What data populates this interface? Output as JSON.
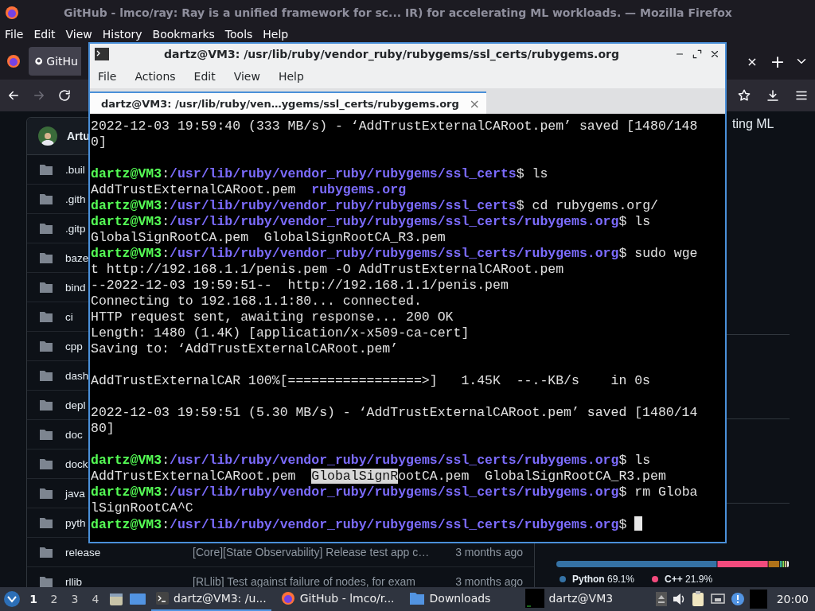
{
  "browser": {
    "title": "GitHub - lmco/ray: Ray is a unified framework for sc... IR) for accelerating ML workloads. — Mozilla Firefox",
    "menu": [
      "File",
      "Edit",
      "View",
      "History",
      "Bookmarks",
      "Tools",
      "Help"
    ],
    "tabs": [
      {
        "label": "GitHu",
        "selected": true
      }
    ],
    "tab_close": "×",
    "new_tab": "+"
  },
  "repo": {
    "owner_fragment": "Artu",
    "files": [
      {
        "name": ".buil"
      },
      {
        "name": ".gith"
      },
      {
        "name": ".gitp"
      },
      {
        "name": "baze"
      },
      {
        "name": "bind"
      },
      {
        "name": "ci"
      },
      {
        "name": "cpp"
      },
      {
        "name": "dash"
      },
      {
        "name": "depl"
      },
      {
        "name": "doc"
      },
      {
        "name": "dock"
      },
      {
        "name": "java"
      },
      {
        "name": "pyth"
      },
      {
        "name": "release",
        "message": "[Core][State Observability] Release test app c…",
        "time": "3 months ago"
      },
      {
        "name": "rllib",
        "message": "[RLlib] Test against failure of nodes, for exam",
        "time": "3 months ago"
      }
    ],
    "description_fragment": "ting ML",
    "languages": [
      {
        "name": "Python",
        "percent": "69.1%",
        "color": "#3572a5"
      },
      {
        "name": "C++",
        "percent": "21.9%",
        "color": "#f34b7d"
      }
    ]
  },
  "terminal": {
    "title": "dartz@VM3: /usr/lib/ruby/vendor_ruby/rubygems/ssl_certs/rubygems.org",
    "menu": [
      "File",
      "Actions",
      "Edit",
      "View",
      "Help"
    ],
    "tabs": [
      {
        "label": "dartz@VM3: /usr/lib/ruby/ven…ygems/ssl_certs/rubygems.org",
        "selected": true
      }
    ],
    "tab_close": "×",
    "lines": [
      {
        "kind": "text",
        "parts": [
          {
            "kind": "plain",
            "text": "2022-12-03 19:59:40 (333 MB/s) - ‘AddTrustExternalCARoot.pem’ saved [1480/148"
          }
        ]
      },
      {
        "kind": "text",
        "parts": [
          {
            "kind": "plain",
            "text": "0]"
          }
        ]
      },
      {
        "kind": "blank"
      },
      {
        "kind": "text",
        "parts": [
          {
            "kind": "user",
            "text": "dartz@VM3"
          },
          {
            "kind": "plain",
            "text": ":"
          },
          {
            "kind": "path",
            "text": "/usr/lib/ruby/vendor_ruby/rubygems/ssl_certs"
          },
          {
            "kind": "plain",
            "text": "$ ls"
          }
        ]
      },
      {
        "kind": "text",
        "parts": [
          {
            "kind": "plain",
            "text": "AddTrustExternalCARoot.pem  "
          },
          {
            "kind": "dir",
            "text": "rubygems.org"
          }
        ]
      },
      {
        "kind": "text",
        "parts": [
          {
            "kind": "user",
            "text": "dartz@VM3"
          },
          {
            "kind": "plain",
            "text": ":"
          },
          {
            "kind": "path",
            "text": "/usr/lib/ruby/vendor_ruby/rubygems/ssl_certs"
          },
          {
            "kind": "plain",
            "text": "$ cd rubygems.org/"
          }
        ]
      },
      {
        "kind": "text",
        "parts": [
          {
            "kind": "user",
            "text": "dartz@VM3"
          },
          {
            "kind": "plain",
            "text": ":"
          },
          {
            "kind": "path",
            "text": "/usr/lib/ruby/vendor_ruby/rubygems/ssl_certs/rubygems.org"
          },
          {
            "kind": "plain",
            "text": "$ ls"
          }
        ]
      },
      {
        "kind": "text",
        "parts": [
          {
            "kind": "plain",
            "text": "GlobalSignRootCA.pem  GlobalSignRootCA_R3.pem"
          }
        ]
      },
      {
        "kind": "text",
        "parts": [
          {
            "kind": "user",
            "text": "dartz@VM3"
          },
          {
            "kind": "plain",
            "text": ":"
          },
          {
            "kind": "path",
            "text": "/usr/lib/ruby/vendor_ruby/rubygems/ssl_certs/rubygems.org"
          },
          {
            "kind": "plain",
            "text": "$ sudo wge"
          }
        ]
      },
      {
        "kind": "text",
        "parts": [
          {
            "kind": "plain",
            "text": "t http://192.168.1.1/penis.pem -O AddTrustExternalCARoot.pem"
          }
        ]
      },
      {
        "kind": "text",
        "parts": [
          {
            "kind": "plain",
            "text": "--2022-12-03 19:59:51--  http://192.168.1.1/penis.pem"
          }
        ]
      },
      {
        "kind": "text",
        "parts": [
          {
            "kind": "plain",
            "text": "Connecting to 192.168.1.1:80... connected."
          }
        ]
      },
      {
        "kind": "text",
        "parts": [
          {
            "kind": "plain",
            "text": "HTTP request sent, awaiting response... 200 OK"
          }
        ]
      },
      {
        "kind": "text",
        "parts": [
          {
            "kind": "plain",
            "text": "Length: 1480 (1.4K) [application/x-x509-ca-cert]"
          }
        ]
      },
      {
        "kind": "text",
        "parts": [
          {
            "kind": "plain",
            "text": "Saving to: ‘AddTrustExternalCARoot.pem’"
          }
        ]
      },
      {
        "kind": "blank"
      },
      {
        "kind": "text",
        "parts": [
          {
            "kind": "plain",
            "text": "AddTrustExternalCAR 100%[=================>]   1.45K  --.-KB/s    in 0s"
          }
        ]
      },
      {
        "kind": "blank"
      },
      {
        "kind": "text",
        "parts": [
          {
            "kind": "plain",
            "text": "2022-12-03 19:59:51 (5.30 MB/s) - ‘AddTrustExternalCARoot.pem’ saved [1480/14"
          }
        ]
      },
      {
        "kind": "text",
        "parts": [
          {
            "kind": "plain",
            "text": "80]"
          }
        ]
      },
      {
        "kind": "blank"
      },
      {
        "kind": "text",
        "parts": [
          {
            "kind": "user",
            "text": "dartz@VM3"
          },
          {
            "kind": "plain",
            "text": ":"
          },
          {
            "kind": "path",
            "text": "/usr/lib/ruby/vendor_ruby/rubygems/ssl_certs/rubygems.org"
          },
          {
            "kind": "plain",
            "text": "$ ls"
          }
        ]
      },
      {
        "kind": "text",
        "parts": [
          {
            "kind": "plain",
            "text": "AddTrustExternalCARoot.pem  "
          },
          {
            "kind": "selected",
            "text": "GlobalSignR"
          },
          {
            "kind": "plain",
            "text": "ootCA.pem  GlobalSignRootCA_R3.pem"
          }
        ]
      },
      {
        "kind": "text",
        "parts": [
          {
            "kind": "user",
            "text": "dartz@VM3"
          },
          {
            "kind": "plain",
            "text": ":"
          },
          {
            "kind": "path",
            "text": "/usr/lib/ruby/vendor_ruby/rubygems/ssl_certs/rubygems.org"
          },
          {
            "kind": "plain",
            "text": "$ rm Globa"
          }
        ]
      },
      {
        "kind": "text",
        "parts": [
          {
            "kind": "plain",
            "text": "lSignRootCA^C"
          }
        ]
      },
      {
        "kind": "text",
        "parts": [
          {
            "kind": "user",
            "text": "dartz@VM3"
          },
          {
            "kind": "plain",
            "text": ":"
          },
          {
            "kind": "path",
            "text": "/usr/lib/ruby/vendor_ruby/rubygems/ssl_certs/rubygems.org"
          },
          {
            "kind": "plain",
            "text": "$ "
          },
          {
            "kind": "cursor"
          }
        ]
      }
    ]
  },
  "taskbar": {
    "workspaces": [
      {
        "label": "1",
        "selected": true
      },
      {
        "label": "2",
        "selected": false
      },
      {
        "label": "3",
        "selected": false
      },
      {
        "label": "4",
        "selected": false
      }
    ],
    "tasks": [
      {
        "kind": "terminal",
        "label": "dartz@VM3: /u...",
        "selected": true
      },
      {
        "kind": "firefox",
        "label": "GitHub - lmco/r...",
        "selected": false
      },
      {
        "kind": "folder",
        "label": "Downloads",
        "selected": false
      }
    ],
    "preview_label": "dartz@VM3",
    "clock": "20:00"
  }
}
